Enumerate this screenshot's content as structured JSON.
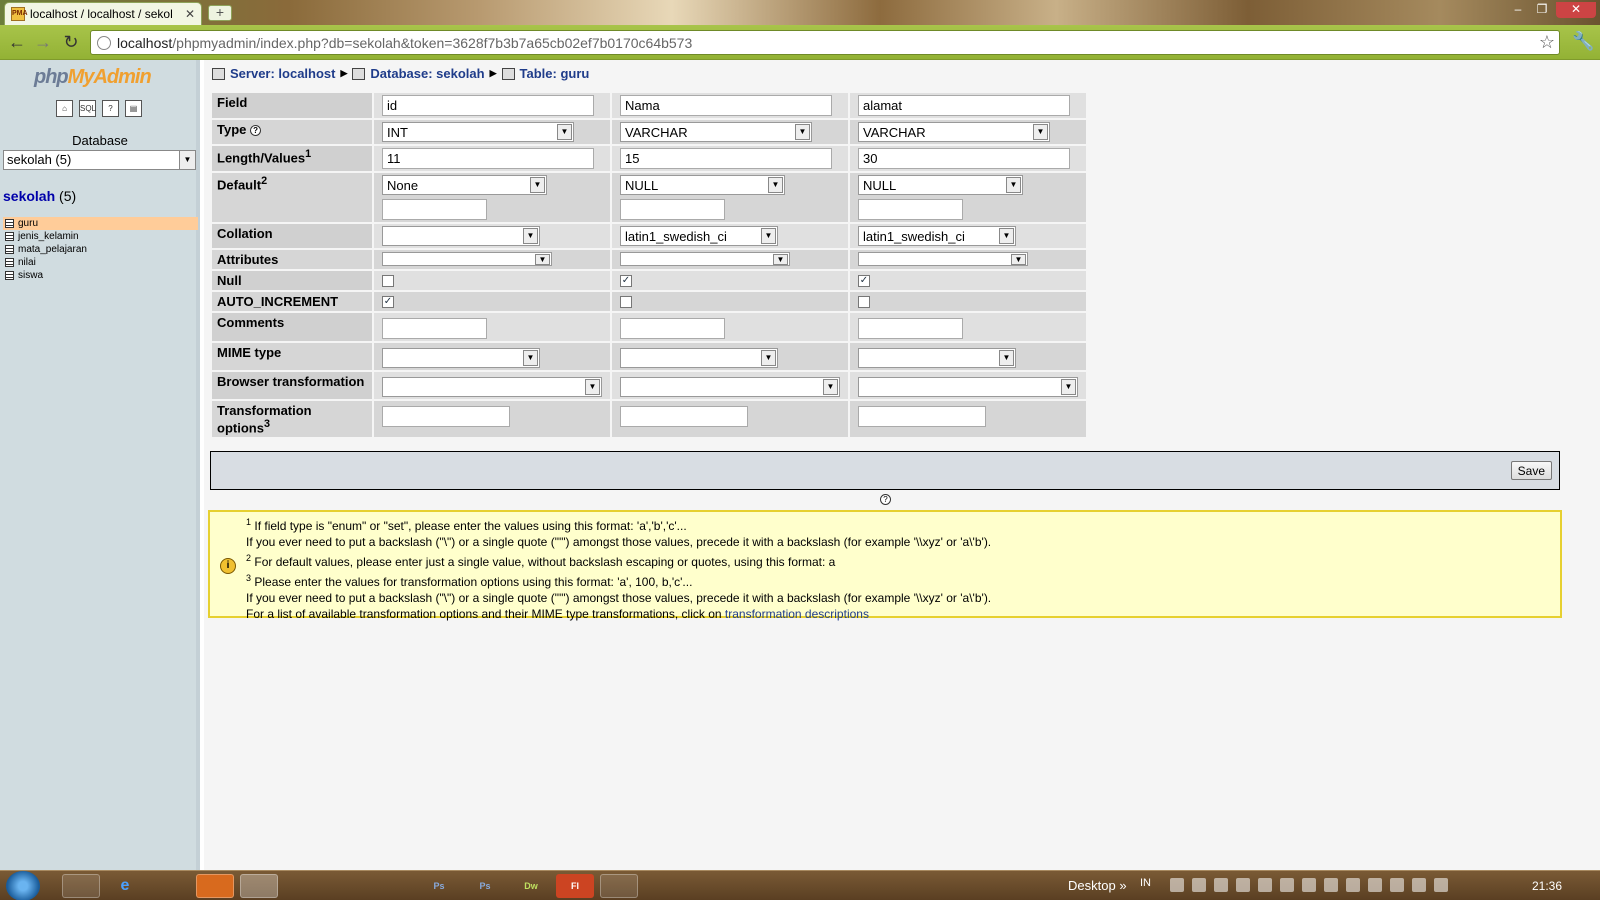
{
  "browser": {
    "tab_title": "localhost / localhost / sekol",
    "url_host": "localhost",
    "url_path": "/phpmyadmin/index.php?db=sekolah&token=3628f7b3b7a65cb02ef7b0170c64b573",
    "favicon_text": "PMA"
  },
  "sidebar": {
    "logo_part1": "php",
    "logo_part2": "MyAdmin",
    "quick_icons": [
      "home-icon",
      "sql-icon",
      "docs-icon",
      "query-window-icon"
    ],
    "database_label": "Database",
    "database_select": "sekolah (5)",
    "db_name": "sekolah",
    "db_count": "(5)",
    "tables": [
      "guru",
      "jenis_kelamin",
      "mata_pelajaran",
      "nilai",
      "siswa"
    ],
    "active_table": "guru"
  },
  "breadcrumb": {
    "server": "Server: localhost",
    "database": "Database: sekolah",
    "table": "Table: guru"
  },
  "form": {
    "labels": {
      "field": "Field",
      "type": "Type",
      "length": "Length/Values",
      "length_sup": "1",
      "default": "Default",
      "default_sup": "2",
      "collation": "Collation",
      "attributes": "Attributes",
      "null": "Null",
      "auto_increment": "AUTO_INCREMENT",
      "comments": "Comments",
      "mime": "MIME type",
      "browser_transformation": "Browser transformation",
      "transformation_options": "Transformation options",
      "transformation_sup": "3"
    },
    "columns": [
      {
        "field": "id",
        "type": "INT",
        "length": "11",
        "default": "None",
        "collation": "",
        "null": false,
        "auto_increment": true
      },
      {
        "field": "Nama",
        "type": "VARCHAR",
        "length": "15",
        "default": "NULL",
        "collation": "latin1_swedish_ci",
        "null": true,
        "auto_increment": false
      },
      {
        "field": "alamat",
        "type": "VARCHAR",
        "length": "30",
        "default": "NULL",
        "collation": "latin1_swedish_ci",
        "null": true,
        "auto_increment": false
      }
    ],
    "save_label": "Save"
  },
  "notice": {
    "n1_sup": "1",
    "n1": "If field type is \"enum\" or \"set\", please enter the values using this format: 'a','b','c'...",
    "n1b": "If you ever need to put a backslash (\"\\\") or a single quote (\"'\") amongst those values, precede it with a backslash (for example '\\\\xyz' or 'a\\'b').",
    "n2_sup": "2",
    "n2": "For default values, please enter just a single value, without backslash escaping or quotes, using this format: a",
    "n3_sup": "3",
    "n3": "Please enter the values for transformation options using this format: 'a', 100, b,'c'...",
    "n3b": "If you ever need to put a backslash (\"\\\") or a single quote (\"'\") amongst those values, precede it with a backslash (for example '\\\\xyz' or 'a\\'b').",
    "n3c": "For a list of available transformation options and their MIME type transformations, click on",
    "link": "transformation descriptions"
  },
  "taskbar": {
    "apps": [
      {
        "name": "explorer-app",
        "label": ""
      },
      {
        "name": "ie-app",
        "label": "e"
      },
      {
        "name": "files-app",
        "label": ""
      },
      {
        "name": "firefox-app",
        "label": ""
      },
      {
        "name": "chrome-app",
        "label": ""
      },
      {
        "name": "thunderbird-app",
        "label": ""
      },
      {
        "name": "notepad-app",
        "label": ""
      },
      {
        "name": "app-7",
        "label": ""
      },
      {
        "name": "photoshop-app",
        "label": "Ps"
      },
      {
        "name": "photoshop-alt-app",
        "label": "Ps"
      },
      {
        "name": "dreamweaver-app",
        "label": "Dw"
      },
      {
        "name": "fireworks-app",
        "label": "Fl"
      },
      {
        "name": "app-12",
        "label": ""
      }
    ],
    "desktop_label": "Desktop",
    "chevron": "»",
    "lang": "IN",
    "clock": "21:36",
    "colors": {
      "taskbar": "#5a3f22",
      "chrome": "#93b235"
    }
  }
}
